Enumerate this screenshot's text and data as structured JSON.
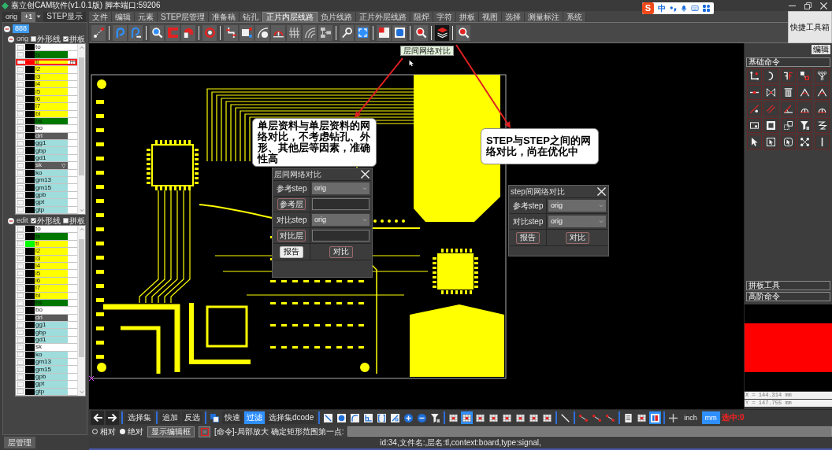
{
  "window": {
    "title": "嘉立创CAM软件(v1.0.1版) 脚本端口:59206"
  },
  "ime_bar": {
    "logo": "S",
    "mode": "中"
  },
  "step_tabs": [
    {
      "label": "orig",
      "selected": false
    },
    {
      "label": "+1",
      "selected": true
    },
    {
      "label": "STEP显示",
      "selected": false
    }
  ],
  "layer_tree": {
    "root": {
      "label": "888",
      "selected": true,
      "expanded": true
    },
    "steps": [
      {
        "name": "orig",
        "expanded": true,
        "options": [
          {
            "label": "外形线",
            "checked": false
          },
          {
            "label": "拼板",
            "checked": true
          }
        ],
        "layers": [
          {
            "name": "to",
            "color": "#ffffff",
            "swatch": {
              "color": "#000000"
            },
            "checked": false,
            "selected": false
          },
          {
            "name": "ts",
            "color": "#007800",
            "swatch": {
              "color": "#000000"
            },
            "checked": false,
            "selected": false
          },
          {
            "name": "tl",
            "color": "#ffff00",
            "swatch": {
              "color": "#ff0000"
            },
            "checked": false,
            "selected": true
          },
          {
            "name": "l2",
            "color": "#ffff00",
            "swatch": {
              "color": "#000000"
            },
            "checked": false,
            "selected": false
          },
          {
            "name": "l3",
            "color": "#ffff00",
            "swatch": {
              "color": "#000000"
            },
            "checked": false,
            "selected": false
          },
          {
            "name": "l4",
            "color": "#ffff00",
            "swatch": {
              "color": "#000000"
            },
            "checked": false,
            "selected": false
          },
          {
            "name": "l5",
            "color": "#ffff00",
            "swatch": {
              "color": "#000000"
            },
            "checked": false,
            "selected": false
          },
          {
            "name": "l6",
            "color": "#ffff00",
            "swatch": {
              "color": "#000000"
            },
            "checked": false,
            "selected": false
          },
          {
            "name": "l7",
            "color": "#ffff00",
            "swatch": {
              "color": "#000000"
            },
            "checked": false,
            "selected": false
          },
          {
            "name": "bl",
            "color": "#ffff00",
            "swatch": {
              "color": "#000000"
            },
            "checked": false,
            "selected": false
          },
          {
            "name": "bs",
            "color": "#007800",
            "swatch": {
              "color": "#000000"
            },
            "checked": false,
            "selected": false
          },
          {
            "name": "bo",
            "color": "#ffffff",
            "swatch": {
              "color": "#000000"
            },
            "checked": false,
            "selected": false
          },
          {
            "name": "drl",
            "color": "#5a5a5a",
            "swatch": {
              "color": "#000000"
            },
            "checked": false,
            "selected": false
          },
          {
            "name": "gg1",
            "color": "#9fdcdc",
            "swatch": {
              "color": "#000000"
            },
            "checked": false,
            "selected": false
          },
          {
            "name": "gbp",
            "color": "#9fdcdc",
            "swatch": {
              "color": "#000000"
            },
            "checked": false,
            "selected": false
          },
          {
            "name": "gd1",
            "color": "#9fdcdc",
            "swatch": {
              "color": "#000000"
            },
            "checked": false,
            "selected": false
          },
          {
            "name": "sk",
            "color": "#5a5a5a",
            "swatch": {
              "color": "#000000"
            },
            "checked": false,
            "selected": false,
            "suffix": "▽"
          },
          {
            "name": "ko",
            "color": "#9fdcdc",
            "swatch": {
              "color": "#000000"
            },
            "checked": false,
            "selected": false
          },
          {
            "name": "gm13",
            "color": "#9fdcdc",
            "swatch": {
              "color": "#000000"
            },
            "checked": false,
            "selected": false
          },
          {
            "name": "gm15",
            "color": "#9fdcdc",
            "swatch": {
              "color": "#000000"
            },
            "checked": false,
            "selected": false
          },
          {
            "name": "gpb",
            "color": "#9fdcdc",
            "swatch": {
              "color": "#000000"
            },
            "checked": false,
            "selected": false
          },
          {
            "name": "gpt",
            "color": "#9fdcdc",
            "swatch": {
              "color": "#000000"
            },
            "checked": false,
            "selected": false
          },
          {
            "name": "gtp",
            "color": "#9fdcdc",
            "swatch": {
              "color": "#000000"
            },
            "checked": false,
            "selected": false
          }
        ]
      },
      {
        "name": "edit",
        "expanded": true,
        "options": [
          {
            "label": "外形线",
            "checked": true
          },
          {
            "label": "拼板",
            "checked": false
          }
        ],
        "layers": [
          {
            "name": "to",
            "color": "#ffffff",
            "swatch": {
              "color": "#000000"
            },
            "checked": false,
            "selected": false
          },
          {
            "name": "ts",
            "color": "#007800",
            "swatch": {
              "color": "#000000"
            },
            "checked": false,
            "selected": false
          },
          {
            "name": "tl",
            "color": "#ffff00",
            "swatch": {
              "color": "#00ff00"
            },
            "checked": false,
            "selected": false
          },
          {
            "name": "l2",
            "color": "#ffff00",
            "swatch": {
              "color": "#000000"
            },
            "checked": false,
            "selected": false
          },
          {
            "name": "l3",
            "color": "#ffff00",
            "swatch": {
              "color": "#000000"
            },
            "checked": false,
            "selected": false
          },
          {
            "name": "l4",
            "color": "#ffff00",
            "swatch": {
              "color": "#000000"
            },
            "checked": false,
            "selected": false
          },
          {
            "name": "l5",
            "color": "#ffff00",
            "swatch": {
              "color": "#000000"
            },
            "checked": false,
            "selected": false
          },
          {
            "name": "l6",
            "color": "#ffff00",
            "swatch": {
              "color": "#000000"
            },
            "checked": false,
            "selected": false
          },
          {
            "name": "l7",
            "color": "#ffff00",
            "swatch": {
              "color": "#000000"
            },
            "checked": false,
            "selected": false
          },
          {
            "name": "bl",
            "color": "#ffff00",
            "swatch": {
              "color": "#000000"
            },
            "checked": false,
            "selected": false
          },
          {
            "name": "bs",
            "color": "#007800",
            "swatch": {
              "color": "#000000"
            },
            "checked": false,
            "selected": false
          },
          {
            "name": "bo",
            "color": "#ffffff",
            "swatch": {
              "color": "#000000"
            },
            "checked": false,
            "selected": false
          },
          {
            "name": "drl",
            "color": "#5a5a5a",
            "swatch": {
              "color": "#000000"
            },
            "checked": false,
            "selected": false
          },
          {
            "name": "gg1",
            "color": "#9fdcdc",
            "swatch": {
              "color": "#000000"
            },
            "checked": false,
            "selected": false
          },
          {
            "name": "gbp",
            "color": "#9fdcdc",
            "swatch": {
              "color": "#000000"
            },
            "checked": false,
            "selected": false
          },
          {
            "name": "gd1",
            "color": "#9fdcdc",
            "swatch": {
              "color": "#000000"
            },
            "checked": false,
            "selected": false
          },
          {
            "name": "sk",
            "color": "#ffffff",
            "swatch": {
              "color": "#000000"
            },
            "checked": false,
            "selected": false
          },
          {
            "name": "ko",
            "color": "#9fdcdc",
            "swatch": {
              "color": "#000000"
            },
            "checked": false,
            "selected": false
          },
          {
            "name": "gm13",
            "color": "#9fdcdc",
            "swatch": {
              "color": "#000000"
            },
            "checked": false,
            "selected": false
          },
          {
            "name": "gm15",
            "color": "#9fdcdc",
            "swatch": {
              "color": "#000000"
            },
            "checked": false,
            "selected": false
          },
          {
            "name": "gpb",
            "color": "#9fdcdc",
            "swatch": {
              "color": "#000000"
            },
            "checked": false,
            "selected": false
          },
          {
            "name": "gpt",
            "color": "#9fdcdc",
            "swatch": {
              "color": "#000000"
            },
            "checked": false,
            "selected": false
          },
          {
            "name": "gtp",
            "color": "#9fdcdc",
            "swatch": {
              "color": "#000000"
            },
            "checked": false,
            "selected": false
          }
        ]
      }
    ]
  },
  "layer_manager_tab": {
    "label": "层管理"
  },
  "menu": [
    {
      "label": "文件",
      "selected": false
    },
    {
      "label": "编辑",
      "selected": false
    },
    {
      "label": "元素",
      "selected": false
    },
    {
      "label": "STEP层管理",
      "selected": false
    },
    {
      "label": "准备稿",
      "selected": false
    },
    {
      "label": "钻孔",
      "selected": false
    },
    {
      "label": "正片内层线路",
      "selected": true
    },
    {
      "label": "负片线路",
      "selected": false
    },
    {
      "label": "正片外层线路",
      "selected": false
    },
    {
      "label": "阻焊",
      "selected": false
    },
    {
      "label": "字符",
      "selected": false
    },
    {
      "label": "拼板",
      "selected": false
    },
    {
      "label": "视图",
      "selected": false
    },
    {
      "label": "选择",
      "selected": false
    },
    {
      "label": "测量标注",
      "selected": false
    },
    {
      "label": "系统",
      "selected": false
    }
  ],
  "toolbar": {
    "tools": [
      {
        "selected": false
      },
      {
        "selected": false
      },
      {
        "selected": false
      },
      {
        "selected": false
      },
      {
        "selected": false
      },
      {
        "selected": false
      },
      {
        "selected": false
      },
      {
        "selected": false
      },
      {
        "selected": false
      },
      {
        "selected": false
      },
      {
        "selected": false
      },
      {
        "selected": false
      },
      {
        "selected": false
      },
      {
        "selected": false
      },
      {
        "selected": false
      },
      {
        "selected": false
      },
      {
        "selected": false
      },
      {
        "selected": false
      },
      {
        "selected": false
      },
      {
        "selected": true
      },
      {
        "selected": false
      }
    ],
    "tooltip": "层间网络对比"
  },
  "quick_toolbox": {
    "label": "快捷工具箱"
  },
  "canvas": {
    "callouts": [
      {
        "text": "单层资料与单层资料的网络对比，不考虑钻孔、外形、其他层等因素，准确性高"
      },
      {
        "text": "STEP与STEP之间的网络对比，尚在优化中"
      }
    ],
    "dialogs": [
      {
        "title": "层间网络对比",
        "fields": [
          {
            "label": "参考step",
            "kind": "select",
            "value": "orig"
          },
          {
            "label": "参考层",
            "kind": "input"
          },
          {
            "label": "对比step",
            "kind": "select",
            "value": "orig"
          },
          {
            "label": "对比层",
            "kind": "input"
          }
        ],
        "buttons": [
          {
            "label": "报告",
            "selected": true
          },
          {
            "label": "对比",
            "selected": false
          }
        ]
      },
      {
        "title": "step间网络对比",
        "fields": [
          {
            "label": "参考step",
            "kind": "select",
            "value": "orig"
          },
          {
            "label": "对比step",
            "kind": "select",
            "value": "orig"
          }
        ],
        "buttons": [
          {
            "label": "报告",
            "selected": false
          },
          {
            "label": "对比",
            "selected": false
          }
        ]
      }
    ]
  },
  "right_panel": {
    "edit_button": "编辑",
    "basic_commands": {
      "title": "基础命令"
    },
    "panel_tools": {
      "title": "拼板工具"
    },
    "advanced_commands": {
      "title": "高阶命令"
    },
    "coordinates": [
      "X = 144.314 mm",
      "Y = 147.755 mm"
    ]
  },
  "bottom_toolbar": {
    "buttons": [
      {
        "label": "选择集",
        "selected": false
      },
      {
        "label": "追加",
        "selected": false
      },
      {
        "label": "反选",
        "selected": false
      },
      {
        "label": "快速",
        "selected": false
      },
      {
        "label": "过滤",
        "selected": true
      },
      {
        "label": "选择集dcode",
        "selected": false
      }
    ],
    "tools": [
      {
        "selected": false
      },
      {
        "selected": false
      },
      {
        "selected": false
      },
      {
        "selected": false
      },
      {
        "selected": false
      },
      {
        "selected": false
      },
      {
        "selected": false
      },
      {
        "selected": false
      },
      {
        "selected": false
      },
      {
        "selected": false
      },
      {
        "selected": true
      },
      {
        "selected": false
      },
      {
        "selected": false
      },
      {
        "selected": false
      },
      {
        "selected": false
      },
      {
        "selected": false
      },
      {
        "selected": false
      },
      {
        "selected": false
      },
      {
        "selected": false
      },
      {
        "selected": false
      },
      {
        "selected": false
      },
      {
        "selected": false
      },
      {
        "selected": false
      },
      {
        "selected": true
      },
      {
        "selected": false
      }
    ],
    "units": [
      {
        "label": "inch",
        "selected": false
      },
      {
        "label": "mm",
        "selected": true
      }
    ],
    "selection_count": "选中:0"
  },
  "command_bar": {
    "coordinate_modes": [
      {
        "label": "相对",
        "selected": false
      },
      {
        "label": "绝对",
        "selected": true
      }
    ],
    "editor_button": "显示编辑框",
    "prompt": "[命令]-局部放大 确定矩形范围第一点:"
  },
  "status_bar": {
    "text": "id:34,文件名:,层名:tl,context:board,type:signal,"
  }
}
